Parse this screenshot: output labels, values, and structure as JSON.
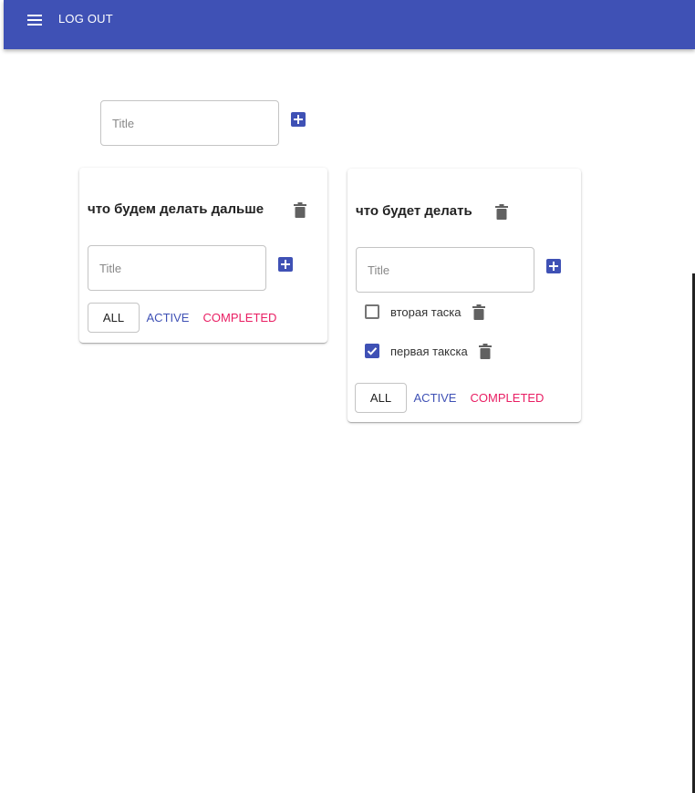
{
  "appbar": {
    "menu_icon": "hamburger-menu-icon",
    "logout_label": "LOG OUT",
    "color": "#3f51b5"
  },
  "new_list": {
    "placeholder": "Title",
    "add_icon": "plus-box-icon"
  },
  "lists": [
    {
      "title": "что будем делать дальше",
      "input_placeholder": "Title",
      "tasks": [],
      "filters": {
        "all": "ALL",
        "active": "ACTIVE",
        "completed": "COMPLETED"
      }
    },
    {
      "title": "что будет делать",
      "input_placeholder": "Title",
      "tasks": [
        {
          "label": "вторая таска",
          "checked": false
        },
        {
          "label": "первая такска",
          "checked": true
        }
      ],
      "filters": {
        "all": "ALL",
        "active": "ACTIVE",
        "completed": "COMPLETED"
      }
    }
  ],
  "colors": {
    "primary": "#3f51b5",
    "secondary": "#e91e63",
    "icon_gray": "#616161"
  }
}
